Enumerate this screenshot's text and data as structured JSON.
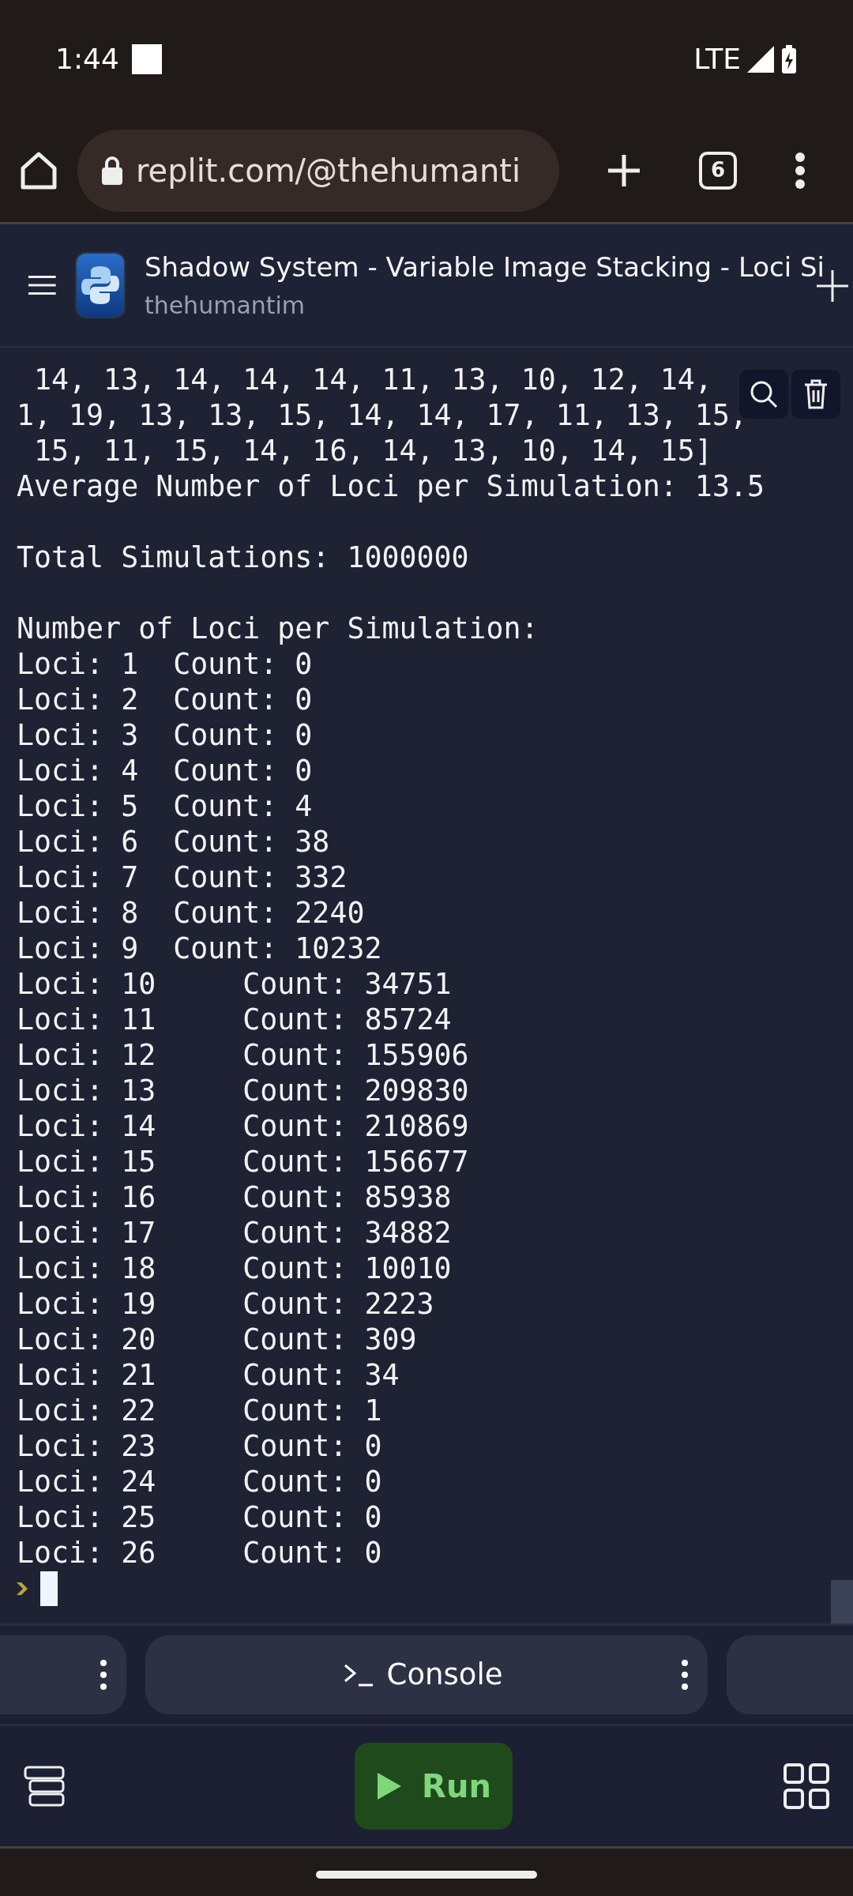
{
  "status_bar": {
    "time": "1:44",
    "network": "LTE"
  },
  "browser": {
    "url": "replit.com/@thehumanti",
    "tab_count": "6"
  },
  "header": {
    "title": "Shadow System - Variable Image Stacking - Loci Si",
    "owner": "thehumantim"
  },
  "console": {
    "blocks": [
      [
        " 14, 13, 14, 14, 14, 11, 13, 10, 12, 14,",
        "1, 19, 13, 13, 15, 14, 14, 17, 11, 13, 15,",
        " 15, 11, 15, 14, 16, 14, 13, 10, 14, 15]",
        "Average Number of Loci per Simulation: 13.5"
      ],
      [
        "Total Simulations: 1000000"
      ],
      [
        "Number of Loci per Simulation:",
        "Loci: 1  Count: 0",
        "Loci: 2  Count: 0",
        "Loci: 3  Count: 0",
        "Loci: 4  Count: 0",
        "Loci: 5  Count: 4",
        "Loci: 6  Count: 38",
        "Loci: 7  Count: 332",
        "Loci: 8  Count: 2240",
        "Loci: 9  Count: 10232",
        "Loci: 10     Count: 34751",
        "Loci: 11     Count: 85724",
        "Loci: 12     Count: 155906",
        "Loci: 13     Count: 209830",
        "Loci: 14     Count: 210869",
        "Loci: 15     Count: 156677",
        "Loci: 16     Count: 85938",
        "Loci: 17     Count: 34882",
        "Loci: 18     Count: 10010",
        "Loci: 19     Count: 2223",
        "Loci: 20     Count: 309",
        "Loci: 21     Count: 34",
        "Loci: 22     Count: 1",
        "Loci: 23     Count: 0",
        "Loci: 24     Count: 0",
        "Loci: 25     Count: 0",
        "Loci: 26     Count: 0"
      ]
    ]
  },
  "tabs": [
    {
      "label": "Console"
    }
  ],
  "run_button": {
    "label": "Run"
  }
}
